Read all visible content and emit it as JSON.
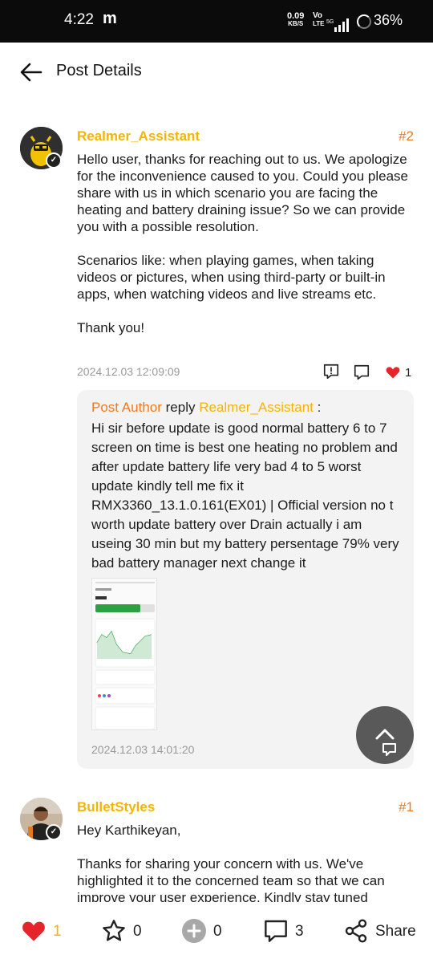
{
  "status_bar": {
    "time": "4:22",
    "carrier_glyph": "m",
    "net_speed_value": "0.09",
    "net_speed_unit": "KB/S",
    "volte_top": "Vo",
    "volte_bottom": "LTE",
    "network_type": "5G",
    "battery": "36%"
  },
  "header": {
    "title": "Post Details"
  },
  "comments": [
    {
      "username": "Realmer_Assistant",
      "floor": "#2",
      "body": "Hello user, thanks for reaching out to us. We apologize for the inconvenience caused to you. Could you please share with us in which scenario you are facing the heating and battery draining issue? So we can provide you with a possible resolution.\n\nScenarios like: when playing games, when taking videos or pictures, when using third-party or built-in apps, when watching videos and live streams etc.\n\nThank you!",
      "date": "2024.12.03 12:09:09",
      "likes": "1",
      "reply": {
        "author_label": "Post Author",
        "reply_word": "reply",
        "to_user": "Realmer_Assistant",
        "colon": " :",
        "text": "Hi sir before update is good normal battery 6 to 7 screen on time is best one heating no problem and after update battery life very bad 4 to 5 worst update kindly tell me fix it RMX3360_13.1.0.161(EX01) | Official version no t worth update battery over Drain actually i am useing 30 min but my battery persentage 79% very bad battery manager next change it",
        "date": "2024.12.03 14:01:20"
      }
    },
    {
      "username": "BulletStyles",
      "floor": "#1",
      "body": "Hey Karthikeyan,\n\nThanks for sharing your concern with us. We've highlighted it to the concerned team so that we can improve your user experience. Kindly stay tuned"
    }
  ],
  "bottom_bar": {
    "likes": "1",
    "favorites": "0",
    "boosts": "0",
    "comments": "3",
    "share_label": "Share"
  },
  "colors": {
    "username": "#f5b400",
    "floor": "#f07a1e",
    "like_red": "#e8242b"
  }
}
